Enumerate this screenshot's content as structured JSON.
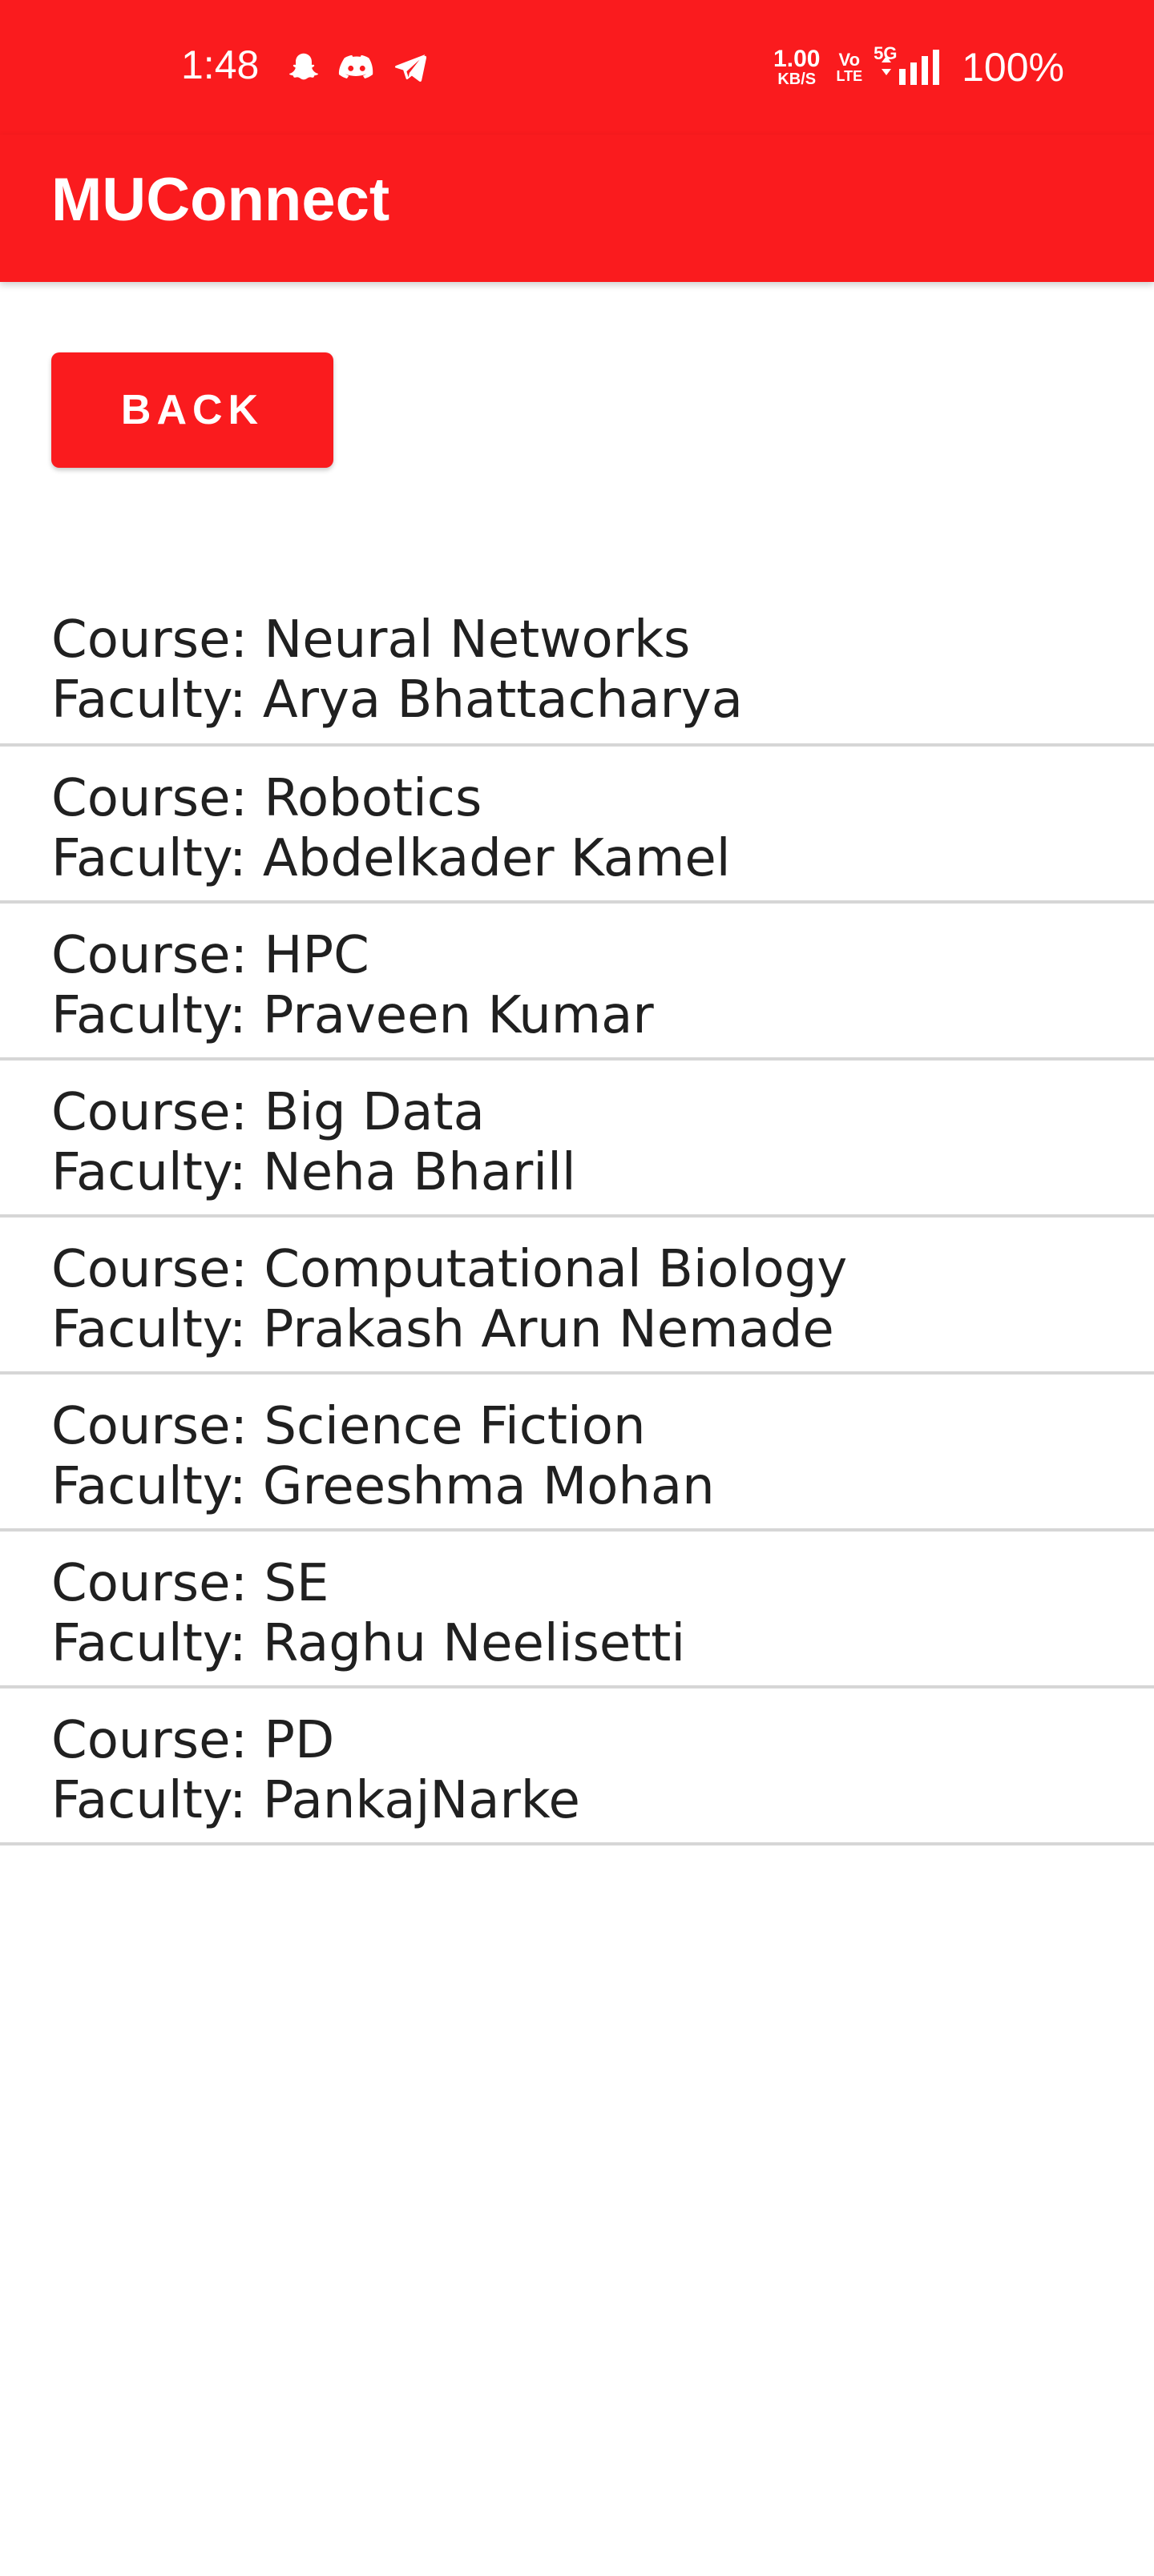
{
  "status_bar": {
    "time": "1:48",
    "net_speed_value": "1.00",
    "net_speed_unit": "KB/S",
    "volte_top": "Vo",
    "volte_bottom": "LTE",
    "network_type": "5G",
    "battery": "100%",
    "notification_icons": [
      "snapchat-icon",
      "discord-icon",
      "telegram-icon"
    ],
    "background_color": "#fa1b1e"
  },
  "app_bar": {
    "title": "MUConnect",
    "background_color": "#fa1b1e"
  },
  "back_button": {
    "label": "BACK"
  },
  "courses": [
    {
      "course": "Course: Neural Networks",
      "faculty": "Faculty: Arya Bhattacharya"
    },
    {
      "course": "Course: Robotics",
      "faculty": "Faculty: Abdelkader Kamel"
    },
    {
      "course": "Course: HPC",
      "faculty": "Faculty: Praveen Kumar"
    },
    {
      "course": "Course: Big Data",
      "faculty": "Faculty: Neha Bharill"
    },
    {
      "course": "Course: Computational Biology",
      "faculty": "Faculty: Prakash Arun Nemade"
    },
    {
      "course": "Course: Science Fiction",
      "faculty": "Faculty: Greeshma Mohan"
    },
    {
      "course": "Course: SE",
      "faculty": "Faculty: Raghu Neelisetti"
    },
    {
      "course": "Course: PD",
      "faculty": "Faculty: PankajNarke"
    }
  ]
}
